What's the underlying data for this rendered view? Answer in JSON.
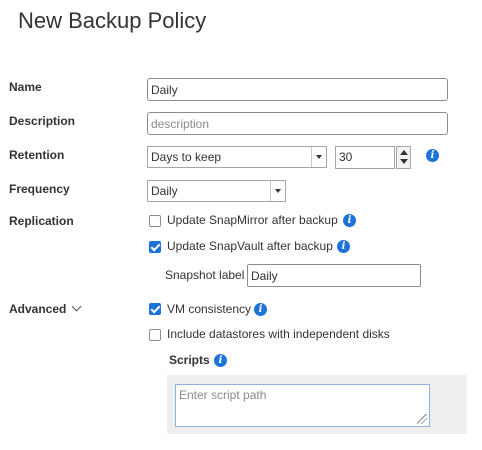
{
  "page": {
    "title": "New Backup Policy"
  },
  "fields": {
    "name": {
      "label": "Name",
      "value": "Daily"
    },
    "description": {
      "label": "Description",
      "placeholder": "description",
      "value": ""
    },
    "retention": {
      "label": "Retention",
      "type_selected": "Days to keep",
      "count_value": "30"
    },
    "frequency": {
      "label": "Frequency",
      "selected": "Daily"
    },
    "replication": {
      "label": "Replication",
      "snapmirror": {
        "label": "Update SnapMirror after backup",
        "checked": false
      },
      "snapvault": {
        "label": "Update SnapVault after backup",
        "checked": true
      },
      "snapshot_label": {
        "label": "Snapshot label",
        "value": "Daily"
      }
    },
    "advanced": {
      "label": "Advanced",
      "vm_consistency": {
        "label": "VM consistency",
        "checked": true
      },
      "independent_disks": {
        "label": "Include datastores with independent disks",
        "checked": false
      },
      "scripts": {
        "label": "Scripts",
        "placeholder": "Enter script path"
      }
    }
  },
  "icons": {
    "info": "i"
  },
  "colors": {
    "accent": "#1e73d9",
    "text": "#333333",
    "scripts_panel": "#eeeeee"
  }
}
